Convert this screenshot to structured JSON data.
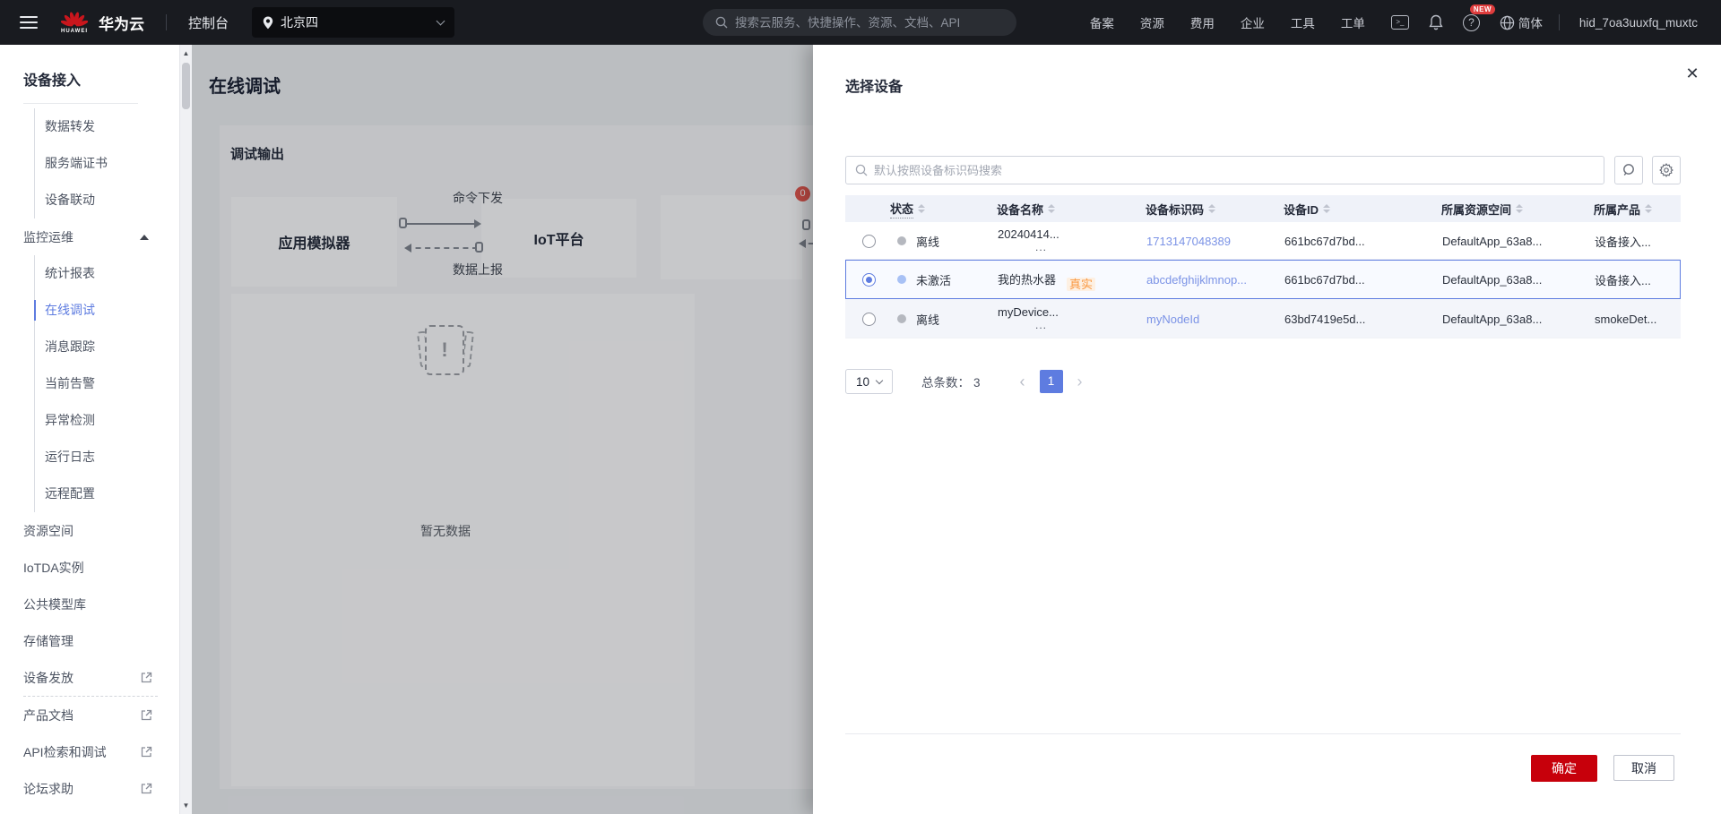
{
  "navbar": {
    "brand_logo_text": "HUAWEI",
    "brand": "华为云",
    "console_label": "控制台",
    "region": "北京四",
    "search_placeholder": "搜索云服务、快捷操作、资源、文档、API",
    "links": [
      "备案",
      "资源",
      "费用",
      "企业",
      "工具",
      "工单"
    ],
    "terminal_glyph": ">_",
    "help_glyph": "?",
    "new_badge": "NEW",
    "language": "简体",
    "username": "hid_7oa3uuxfq_muxtc"
  },
  "sidebar": {
    "title": "设备接入",
    "group_items": [
      "数据转发",
      "服务端证书",
      "设备联动"
    ],
    "section_label": "监控运维",
    "section_items": [
      "统计报表",
      "在线调试",
      "消息跟踪",
      "当前告警",
      "异常检测",
      "运行日志",
      "远程配置"
    ],
    "active_item": "在线调试",
    "plain_items": [
      "资源空间",
      "IoTDA实例",
      "公共模型库",
      "存储管理"
    ],
    "external_item_top": "设备发放",
    "external_items": [
      "产品文档",
      "API检索和调试",
      "论坛求助"
    ]
  },
  "main": {
    "page_title": "在线调试",
    "panel_title": "调试输出",
    "diagram": {
      "app_box": "应用模拟器",
      "iot_box": "IoT平台",
      "cmd_label": "命令下发",
      "data_label": "数据上报",
      "badge_count": "0"
    },
    "empty_icon_mark": "!",
    "empty_text": "暂无数据"
  },
  "modal": {
    "title": "选择设备",
    "search_placeholder": "默认按照设备标识码搜索",
    "columns": [
      "状态",
      "设备名称",
      "设备标识码",
      "设备ID",
      "所属资源空间",
      "所属产品"
    ],
    "rows": [
      {
        "status": "离线",
        "name": "20240414...",
        "name_more": "...",
        "tag": "",
        "code": "1713147048389",
        "device_id": "661bc67d7bd...",
        "space": "DefaultApp_63a8...",
        "product": "设备接入..."
      },
      {
        "status": "未激活",
        "name": "我的热水器",
        "name_more": "",
        "tag": "真实",
        "code": "abcdefghijklmnop...",
        "device_id": "661bc67d7bd...",
        "space": "DefaultApp_63a8...",
        "product": "设备接入..."
      },
      {
        "status": "离线",
        "name": "myDevice...",
        "name_more": "...",
        "tag": "",
        "code": "myNodeId",
        "device_id": "63bd7419e5d...",
        "space": "DefaultApp_63a8...",
        "product": "smokeDet..."
      }
    ],
    "pagination": {
      "page_size": "10",
      "total_label": "总条数：",
      "total": "3",
      "page": "1"
    },
    "confirm_label": "确定",
    "cancel_label": "取消"
  },
  "icons": {
    "close": "✕",
    "scroll_up": "▲",
    "scroll_down": "▼",
    "prev": "‹",
    "next": "›"
  },
  "colors": {
    "accent": "#5e7ce0",
    "link": "#7b93e6",
    "huawei_red": "#c7000b",
    "badge_red": "#e4564e",
    "tag_orange": "#fa9841",
    "offline_dot": "#b5b8bf",
    "inactive_dot": "#a8c1f5"
  }
}
